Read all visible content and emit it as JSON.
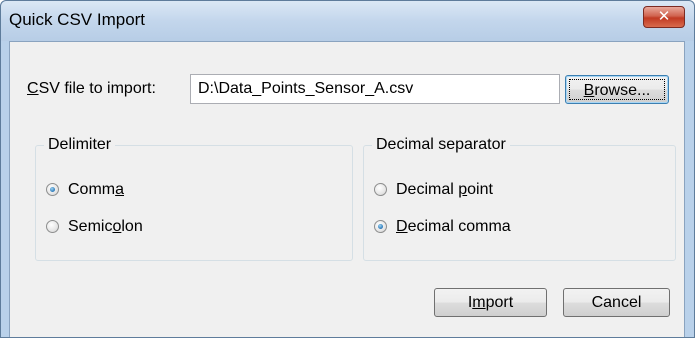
{
  "window": {
    "title": "Quick CSV Import",
    "close_symbol": "✕"
  },
  "file": {
    "label_u": "C",
    "label_rest": "SV file to import:",
    "value": "D:\\Data_Points_Sensor_A.csv",
    "browse_u": "B",
    "browse_rest": "rowse..."
  },
  "delimiter": {
    "title": "Delimiter",
    "comma_pre": "Comm",
    "comma_u": "a",
    "comma_post": "",
    "comma_checked": true,
    "semicolon_pre": "Semic",
    "semicolon_u": "o",
    "semicolon_post": "lon",
    "semicolon_checked": false
  },
  "decimal": {
    "title": "Decimal separator",
    "point_pre": "Decimal ",
    "point_u": "p",
    "point_post": "oint",
    "point_checked": false,
    "comma_pre": "",
    "comma_u": "D",
    "comma_post": "ecimal comma",
    "comma_checked": true
  },
  "buttons": {
    "import_pre": "I",
    "import_u": "m",
    "import_post": "port",
    "cancel": "Cancel"
  },
  "colors": {
    "frame": "#b9d1ea",
    "client": "#f0f0f0",
    "close": "#c13a23",
    "radio_dot": "#2a78b8"
  }
}
